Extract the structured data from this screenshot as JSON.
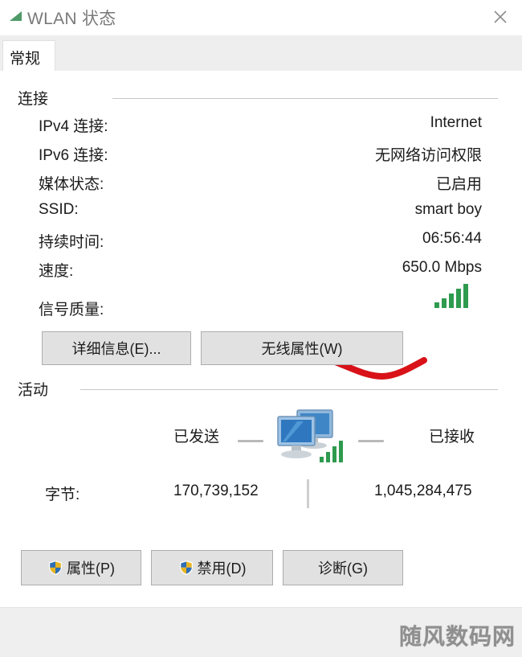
{
  "window": {
    "title": "WLAN 状态",
    "icon": "wifi-signal-icon",
    "close_label": "✕"
  },
  "tabs": [
    {
      "label": "常规",
      "selected": true
    }
  ],
  "connection": {
    "header": "连接",
    "rows": [
      {
        "label": "IPv4 连接:",
        "value": "Internet"
      },
      {
        "label": "IPv6 连接:",
        "value": "无网络访问权限"
      },
      {
        "label": "媒体状态:",
        "value": "已启用"
      },
      {
        "label": "SSID:",
        "value": "smart boy"
      },
      {
        "label": "持续时间:",
        "value": "06:56:44"
      },
      {
        "label": "速度:",
        "value": "650.0 Mbps"
      },
      {
        "label": "信号质量:",
        "value": ""
      }
    ],
    "signal_icon": "signal-bars-icon",
    "signal_bars_filled": 5,
    "buttons": [
      {
        "label": "详细信息(E)...",
        "name": "details-button"
      },
      {
        "label": "无线属性(W)",
        "name": "wireless-properties-button"
      }
    ]
  },
  "activity": {
    "header": "活动",
    "sent_label": "已发送",
    "received_label": "已接收",
    "icon": "network-monitors-icon",
    "bytes_label": "字节:",
    "bytes_sent": "170,739,152",
    "bytes_received": "1,045,284,475"
  },
  "footer_buttons": [
    {
      "label": "属性(P)",
      "name": "properties-button",
      "shield": true
    },
    {
      "label": "禁用(D)",
      "name": "disable-button",
      "shield": true
    },
    {
      "label": "诊断(G)",
      "name": "diagnose-button",
      "shield": false
    }
  ],
  "watermark": {
    "text": "随风数码网"
  },
  "annotation": {
    "type": "hand-drawn-line",
    "color": "#d81218",
    "target": "speed"
  },
  "colors": {
    "signal_green": "#2e9b4f",
    "shield_blue": "#2f6fb5",
    "shield_gold": "#e9b521",
    "annotation_red": "#d81218",
    "button_face": "#e1e1e1",
    "tabstrip": "#eeeeee"
  }
}
